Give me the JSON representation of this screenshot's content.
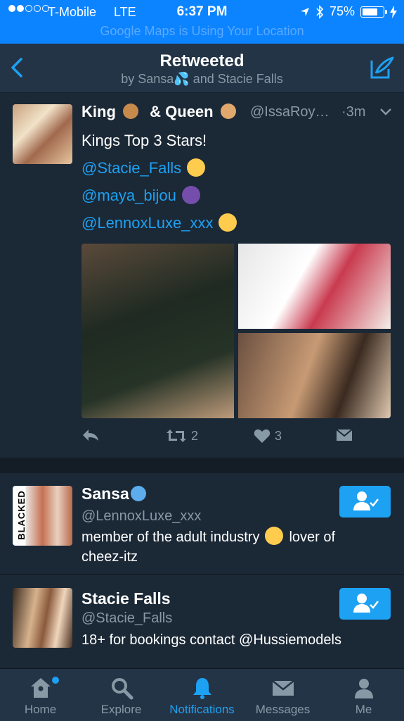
{
  "status_bar": {
    "carrier": "T-Mobile",
    "network": "LTE",
    "time": "6:37 PM",
    "battery": "75%",
    "battery_level": 0.75,
    "location_banner": "Google Maps is Using Your Location",
    "icons": [
      "location-arrow-icon",
      "bluetooth-icon",
      "battery-icon",
      "charging-icon"
    ]
  },
  "nav": {
    "title": "Retweeted",
    "subtitle": "by Sansa💦 and Stacie Falls"
  },
  "tweet": {
    "name_part1": "King",
    "name_part2": "& Queen",
    "handle": "@IssaRoy…",
    "time": "·3m",
    "lines": [
      "Kings Top 3 Stars!"
    ],
    "mentions": [
      "@Stacie_Falls",
      "@maya_bijou",
      "@LennoxLuxe_xxx"
    ],
    "retweets": "2",
    "likes": "3"
  },
  "users": [
    {
      "name": "Sansa",
      "handle": "@LennoxLuxe_xxx",
      "bio_line1": "member of the adult industry",
      "bio_line1b": "lover of",
      "bio_line2": "cheez-itz",
      "avatar_watermark": "BLACKED"
    },
    {
      "name": "Stacie Falls",
      "handle": "@Stacie_Falls",
      "bio_line1": "18+ for bookings contact @Hussiemodels"
    }
  ],
  "tabs": [
    {
      "label": "Home",
      "icon": "home-icon"
    },
    {
      "label": "Explore",
      "icon": "search-icon"
    },
    {
      "label": "Notifications",
      "icon": "bell-icon"
    },
    {
      "label": "Messages",
      "icon": "envelope-icon"
    },
    {
      "label": "Me",
      "icon": "profile-icon"
    }
  ],
  "colors": {
    "status_bar": "#0d84ff",
    "background": "#1b2836",
    "nav_background": "#243447",
    "accent": "#1da1f2",
    "muted_text": "#8899a6"
  }
}
